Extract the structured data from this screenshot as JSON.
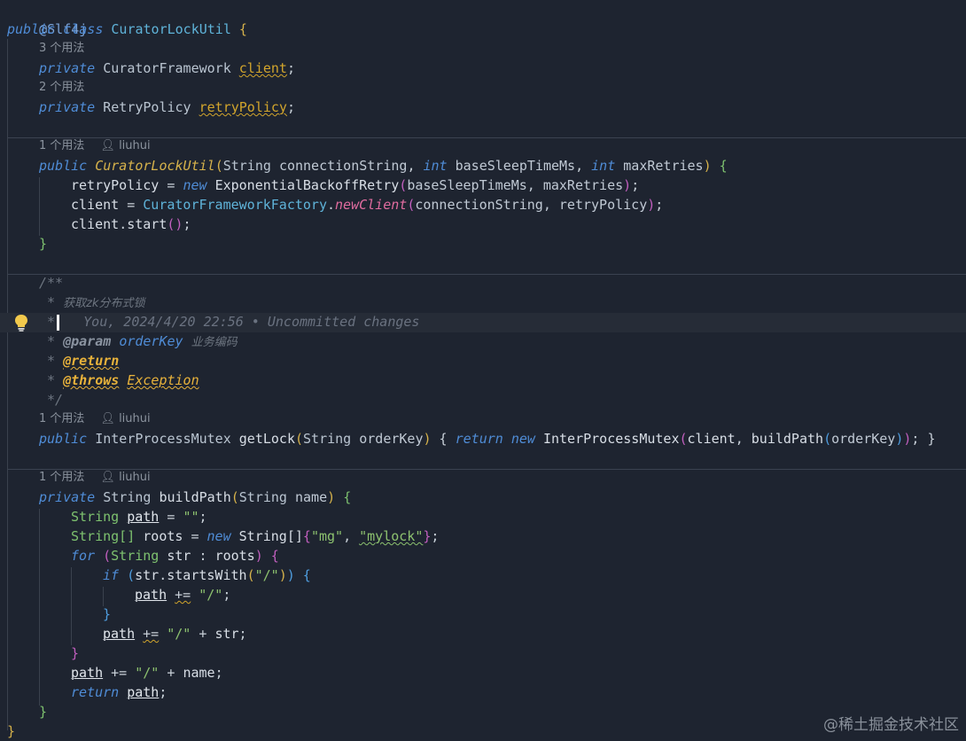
{
  "annotation": "@Slf4j",
  "class_decl": {
    "kw": "public class",
    "name": "CuratorLockUtil",
    "brace": "{"
  },
  "usages": {
    "u3": "3 个用法",
    "u2": "2 个用法",
    "u1": "1 个用法"
  },
  "author": "liuhui",
  "fields": [
    {
      "kw": "private",
      "type": "CuratorFramework",
      "name": "client"
    },
    {
      "kw": "private",
      "type": "RetryPolicy",
      "name": "retryPolicy"
    }
  ],
  "ctor": {
    "kw": "public",
    "name": "CuratorLockUtil",
    "p1type": "String",
    "p1": "connectionString",
    "p2type": "int",
    "p2": "baseSleepTimeMs",
    "p3type": "int",
    "p3": "maxRetries",
    "l1a": "retryPolicy",
    "l1new": "new",
    "l1cls": "ExponentialBackoffRetry",
    "l1args": "baseSleepTimeMs, maxRetries",
    "l2a": "client",
    "l2cls": "CuratorFrameworkFactory",
    "l2m": "newClient",
    "l2args": "connectionString, retryPolicy",
    "l3": "client",
    "l3m": "start"
  },
  "javadoc": {
    "open": "/**",
    "desc_prefix": " * ",
    "desc": "获取zk分布式锁",
    "star": " *",
    "blame": "You, 2024/4/20 22:56 • Uncommitted changes",
    "param_tag": "@param",
    "param_name": "orderKey",
    "param_desc": "业务编码",
    "return_tag": "@return",
    "throws_tag": "@throws",
    "throws_type": "Exception",
    "close": " */"
  },
  "getlock": {
    "kw": "public",
    "ret": "InterProcessMutex",
    "name": "getLock",
    "ptype": "String",
    "pname": "orderKey",
    "body_return": "return",
    "body_new": "new",
    "cls": "InterProcessMutex",
    "arg1": "client",
    "fn": "buildPath",
    "arg2": "orderKey"
  },
  "buildpath": {
    "kw": "private",
    "ret": "String",
    "name": "buildPath",
    "ptype": "String",
    "pname": "name",
    "l1type": "String",
    "l1var": "path",
    "l1val": "\"\"",
    "l2type": "String[]",
    "l2var": "roots",
    "l2new": "new",
    "l2cls": "String[]",
    "l2s1": "\"mg\"",
    "l2s2": "\"mylock\"",
    "for_kw": "for",
    "for_type": "String",
    "for_var": "str",
    "for_src": "roots",
    "if_kw": "if",
    "if_obj": "str",
    "if_m": "startsWith",
    "if_arg": "\"/\"",
    "if_body_var": "path",
    "if_body_val": "\"/\"",
    "for_body_var": "path",
    "for_body_val": "\"/\"",
    "for_body_tail": "str",
    "after_var": "path",
    "after_val": "\"/\"",
    "after_tail": "name",
    "ret_kw": "return",
    "ret_var": "path"
  },
  "watermark": "@稀土掘金技术社区",
  "colors": {
    "background": "#1e2430",
    "keyword": "#4f8cd6",
    "field": "#d2a52c",
    "string": "#8dc26f",
    "comment": "#6d7580"
  }
}
